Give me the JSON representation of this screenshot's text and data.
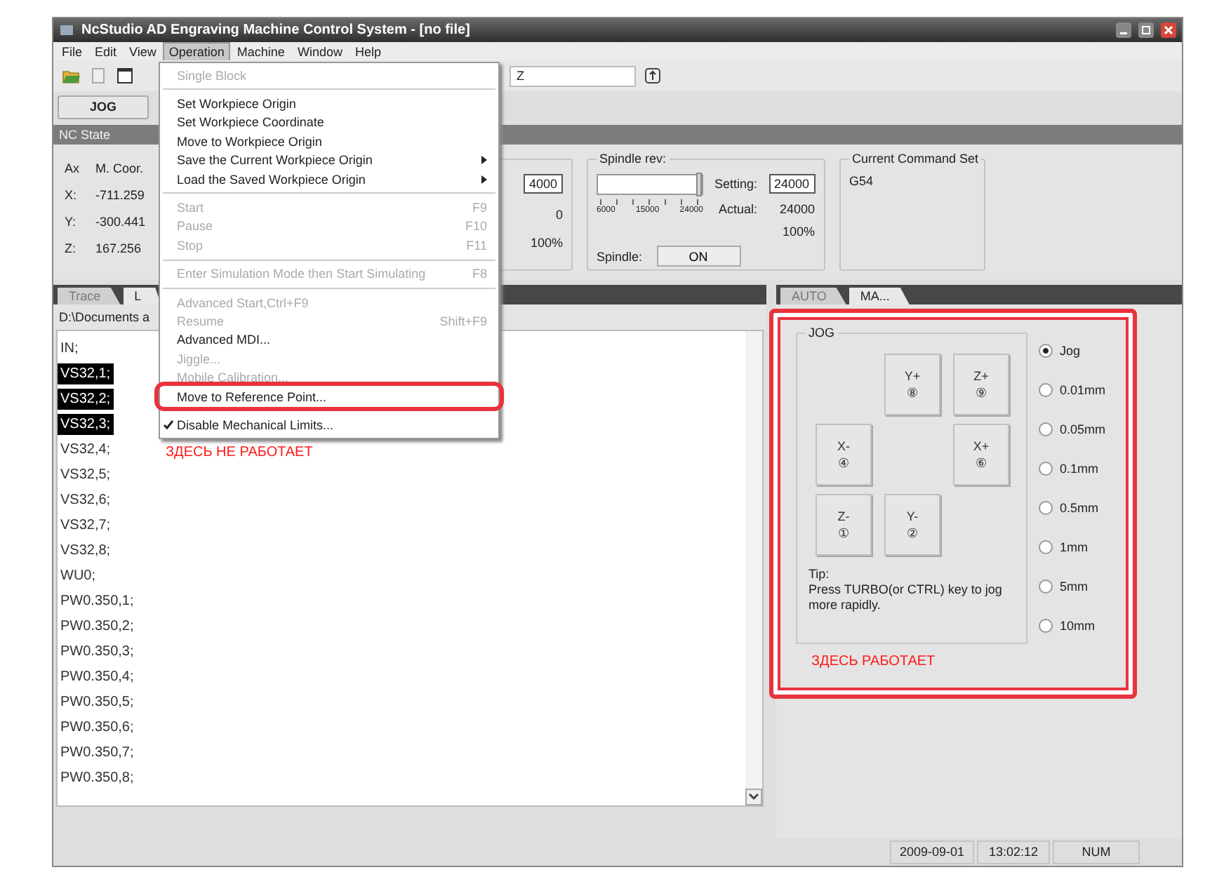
{
  "window": {
    "title": "NcStudio AD  Engraving Machine Control System - [no file]"
  },
  "menu_bar": [
    {
      "label": "File",
      "selected": false
    },
    {
      "label": "Edit",
      "selected": false
    },
    {
      "label": "View",
      "selected": false
    },
    {
      "label": "Operation",
      "selected": true
    },
    {
      "label": "Machine",
      "selected": false
    },
    {
      "label": "Window",
      "selected": false
    },
    {
      "label": "Help",
      "selected": false
    }
  ],
  "toolbar": {
    "field_value": "Z"
  },
  "mode_buttons": [
    "JOG"
  ],
  "nc_state": {
    "title": "NC State",
    "axes": {
      "headers": [
        "Ax",
        "M. Coor."
      ],
      "rows": [
        [
          "X:",
          "-711.259"
        ],
        [
          "Y:",
          "-300.441"
        ],
        [
          "Z:",
          "167.256"
        ]
      ]
    },
    "feed": {
      "setting": "4000",
      "actual": "0",
      "percent": "100%"
    },
    "spindle": {
      "title": "Spindle rev:",
      "level": 1,
      "ticks": [
        "6000",
        "15000",
        "24000"
      ],
      "setting_label": "Setting:",
      "setting": "24000",
      "actual_label": "Actual:",
      "actual": "24000",
      "percent": "100%",
      "switch_label": "Spindle:",
      "switch_button": "ON"
    },
    "command_set": {
      "title": "Current Command Set",
      "value": "G54"
    }
  },
  "left_panel": {
    "tabs": [
      {
        "label": "Trace",
        "selected": false
      },
      {
        "label": "L",
        "selected": true
      }
    ],
    "path": "D:\\Documents a",
    "lines": [
      {
        "text": "IN;",
        "selected": false
      },
      {
        "text": "VS32,1;",
        "selected": true
      },
      {
        "text": "VS32,2;",
        "selected": true
      },
      {
        "text": "VS32,3;",
        "selected": true
      },
      {
        "text": "VS32,4;",
        "selected": false
      },
      {
        "text": "VS32,5;",
        "selected": false
      },
      {
        "text": "VS32,6;",
        "selected": false
      },
      {
        "text": "VS32,7;",
        "selected": false
      },
      {
        "text": "VS32,8;",
        "selected": false
      },
      {
        "text": "WU0;",
        "selected": false
      },
      {
        "text": "PW0.350,1;",
        "selected": false
      },
      {
        "text": "PW0.350,2;",
        "selected": false
      },
      {
        "text": "PW0.350,3;",
        "selected": false
      },
      {
        "text": "PW0.350,4;",
        "selected": false
      },
      {
        "text": "PW0.350,5;",
        "selected": false
      },
      {
        "text": "PW0.350,6;",
        "selected": false
      },
      {
        "text": "PW0.350,7;",
        "selected": false
      },
      {
        "text": "PW0.350,8;",
        "selected": false
      }
    ]
  },
  "right_panel": {
    "tabs": [
      {
        "label": "AUTO",
        "selected": false
      },
      {
        "label": "MA...",
        "selected": true
      }
    ],
    "jog": {
      "title": "JOG",
      "grid": [
        [
          {
            "kind": "blank"
          },
          {
            "kind": "button",
            "axis": "Y+",
            "key": "⑧"
          },
          {
            "kind": "button",
            "axis": "Z+",
            "key": "⑨"
          }
        ],
        [
          {
            "kind": "button",
            "axis": "X-",
            "key": "④"
          },
          {
            "kind": "blank"
          },
          {
            "kind": "button",
            "axis": "X+",
            "key": "⑥"
          }
        ],
        [
          {
            "kind": "button",
            "axis": "Z-",
            "key": "①"
          },
          {
            "kind": "button",
            "axis": "Y-",
            "key": "②"
          },
          {
            "kind": "blank"
          }
        ]
      ],
      "tip_title": "Tip:",
      "tip": "Press TURBO(or CTRL) key to jog more rapidly."
    },
    "steps": [
      {
        "label": "Jog",
        "selected": true
      },
      {
        "label": "0.01mm",
        "selected": false
      },
      {
        "label": "0.05mm",
        "selected": false
      },
      {
        "label": "0.1mm",
        "selected": false
      },
      {
        "label": "0.5mm",
        "selected": false
      },
      {
        "label": "1mm",
        "selected": false
      },
      {
        "label": "5mm",
        "selected": false
      },
      {
        "label": "10mm",
        "selected": false
      }
    ]
  },
  "status_bar": [
    "2009-09-01",
    "13:02:12",
    "NUM"
  ],
  "operation_menu": [
    {
      "kind": "item",
      "label": "Single Block",
      "disabled": true
    },
    {
      "kind": "separator"
    },
    {
      "kind": "item",
      "label": "Set Workpiece Origin",
      "disabled": false
    },
    {
      "kind": "item",
      "label": "Set Workpiece Coordinate",
      "disabled": false
    },
    {
      "kind": "item",
      "label": "Move to Workpiece Origin",
      "disabled": false
    },
    {
      "kind": "item",
      "label": "Save the Current Workpiece Origin",
      "disabled": false,
      "submenu": true
    },
    {
      "kind": "item",
      "label": "Load the Saved Workpiece Origin",
      "disabled": false,
      "submenu": true
    },
    {
      "kind": "separator"
    },
    {
      "kind": "item",
      "label": "Start",
      "shortcut": "F9",
      "disabled": true
    },
    {
      "kind": "item",
      "label": "Pause",
      "shortcut": "F10",
      "disabled": true
    },
    {
      "kind": "item",
      "label": "Stop",
      "shortcut": "F11",
      "disabled": true
    },
    {
      "kind": "separator"
    },
    {
      "kind": "item",
      "label": "Enter Simulation Mode then Start Simulating",
      "shortcut": "F8",
      "disabled": true
    },
    {
      "kind": "separator"
    },
    {
      "kind": "item",
      "label": "Advanced Start,Ctrl+F9",
      "disabled": true
    },
    {
      "kind": "item",
      "label": "Resume",
      "shortcut": "Shift+F9",
      "disabled": true
    },
    {
      "kind": "item",
      "label": "Advanced MDI...",
      "disabled": false
    },
    {
      "kind": "item",
      "label": "Jiggle...",
      "disabled": true
    },
    {
      "kind": "item",
      "label": "Mobile Calibration...",
      "disabled": true
    },
    {
      "kind": "item",
      "label": "Move to Reference Point...",
      "disabled": false,
      "highlighted": true
    },
    {
      "kind": "separator"
    },
    {
      "kind": "item",
      "label": "Disable Mechanical Limits...",
      "disabled": false,
      "checked": true
    }
  ],
  "annotations": [
    {
      "kind": "menu",
      "label": "ЗДЕСЬ НЕ РАБОТАЕТ"
    },
    {
      "kind": "jog",
      "label": "ЗДЕСЬ РАБОТАЕТ"
    }
  ]
}
